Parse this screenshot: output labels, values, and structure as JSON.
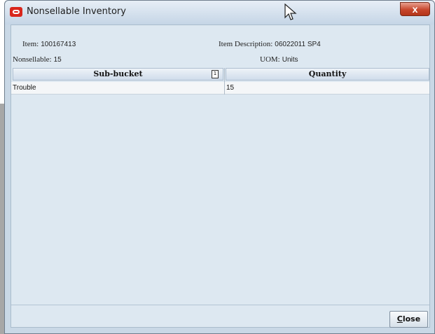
{
  "window": {
    "title": "Nonsellable Inventory",
    "close_glyph": "x",
    "icon": "oracle-app-icon"
  },
  "details": {
    "item_label": "Item:",
    "item_value": "100167413",
    "description_label": "Item Description:",
    "description_value": "06022011 SP4",
    "nonsellable_label": "Nonsellable:",
    "nonsellable_value": "15",
    "uom_label": "UOM:",
    "uom_value": "Units"
  },
  "table": {
    "columns": [
      "Sub-bucket",
      "Quantity"
    ],
    "sort_indicator": "1",
    "rows": [
      [
        "Trouble",
        "15"
      ]
    ]
  },
  "footer": {
    "close_mnemonic": "C",
    "close_rest": "lose"
  }
}
